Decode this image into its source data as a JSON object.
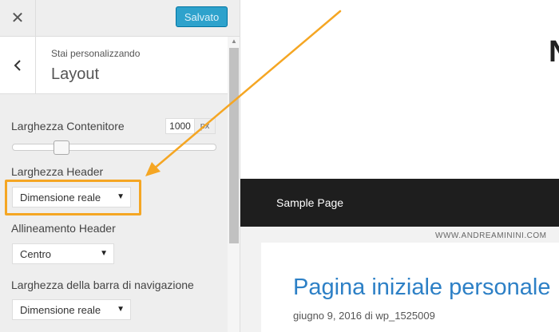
{
  "topbar": {
    "close_icon": "close-icon",
    "save_label": "Salvato"
  },
  "section": {
    "back_icon": "chevron-left-icon",
    "customizing_label": "Stai personalizzando",
    "title": "Layout"
  },
  "fields": {
    "container_width": {
      "label": "Larghezza Contenitore",
      "value": "1000",
      "unit": "px",
      "slider_fraction": 0.24
    },
    "header_width": {
      "label": "Larghezza Header",
      "selected": "Dimensione reale"
    },
    "header_alignment": {
      "label": "Allineamento Header",
      "selected": "Centro"
    },
    "nav_width": {
      "label": "Larghezza della barra di navigazione",
      "selected": "Dimensione reale"
    }
  },
  "preview": {
    "logo_fragment": "N",
    "nav_link": "Sample Page",
    "watermark": "WWW.ANDREAMININI.COM",
    "post_title": "Pagina iniziale personale",
    "post_meta": "giugno 9, 2016 di wp_1525009"
  },
  "colors": {
    "accent_button": "#2ea2cc",
    "annotation": "#f5a623",
    "nav_background": "#1e1e1e",
    "link": "#2d80c6"
  }
}
